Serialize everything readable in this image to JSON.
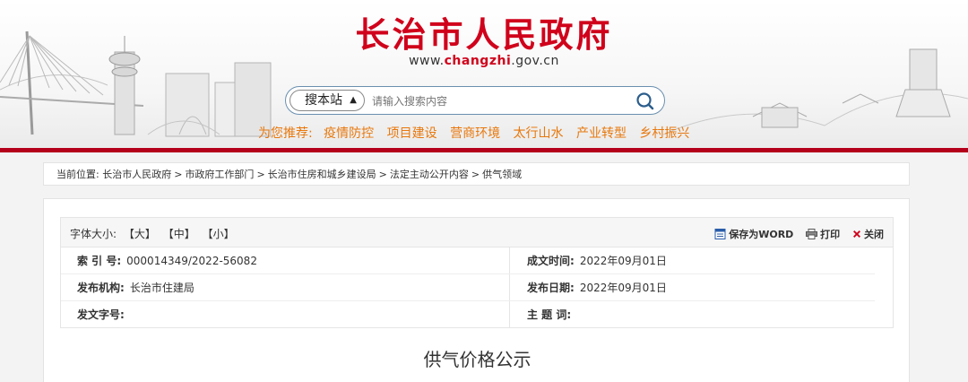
{
  "header": {
    "site_title": "长治市人民政府",
    "site_url_prefix": "www.",
    "site_url_domain": "changzhi",
    "site_url_suffix": ".gov.cn",
    "brand_color": "#d0021b"
  },
  "search": {
    "site_scope": "搜本站",
    "placeholder": "请输入搜索内容",
    "button_icon": "search-icon"
  },
  "recommend": {
    "label": "为您推荐:",
    "items": [
      "疫情防控",
      "项目建设",
      "营商环境",
      "太行山水",
      "产业转型",
      "乡村振兴"
    ],
    "color": "#e8780c"
  },
  "breadcrumb": {
    "label": "当前位置:",
    "items": [
      "长治市人民政府",
      "市政府工作部门",
      "长治市住房和城乡建设局",
      "法定主动公开内容",
      "供气领域"
    ],
    "separator": ">"
  },
  "toolbar": {
    "font_size_label": "字体大小:",
    "font_options": [
      "【大】",
      "【中】",
      "【小】"
    ],
    "save_word": "保存为WORD",
    "print": "打印",
    "close": "关闭"
  },
  "meta": {
    "index_key": "索 引 号:",
    "index_val": "000014349/2022-56082",
    "created_key": "成文时间:",
    "created_val": "2022年09月01日",
    "org_key": "发布机构:",
    "org_val": "长治市住建局",
    "published_key": "发布日期:",
    "published_val": "2022年09月01日",
    "doc_no_key": "发文字号:",
    "doc_no_val": "",
    "subject_key": "主 题 词:",
    "subject_val": ""
  },
  "article": {
    "title": "供气价格公示"
  }
}
